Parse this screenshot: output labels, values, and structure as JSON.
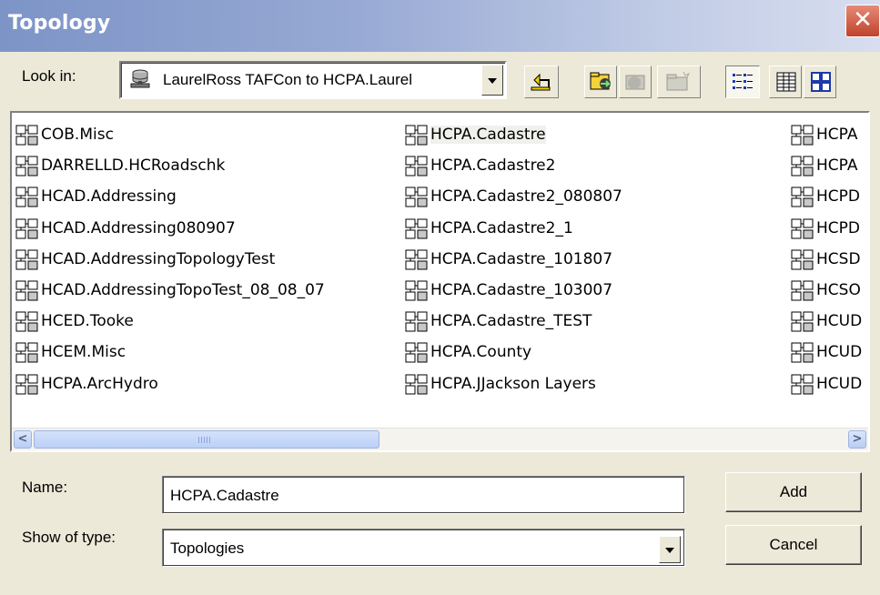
{
  "window": {
    "title": "Topology",
    "close_glyph": "✕"
  },
  "toolbar": {
    "look_in_label": "Look in:",
    "look_in_value": "LaurelRoss TAFCon to HCPA.Laurel",
    "buttons": [
      "up-one-level-icon",
      "connect-to-folder-icon",
      "disconnect-folder-icon",
      "new-folder-icon",
      "list-view-icon",
      "details-view-icon",
      "thumbnails-view-icon"
    ]
  },
  "files": {
    "column1": [
      "COB.Misc",
      "DARRELLD.HCRoadschk",
      "HCAD.Addressing",
      "HCAD.Addressing080907",
      "HCAD.AddressingTopologyTest",
      "HCAD.AddressingTopoTest_08_08_07",
      "HCED.Tooke",
      "HCEM.Misc",
      "HCPA.ArcHydro"
    ],
    "column2": [
      "HCPA.Cadastre",
      "HCPA.Cadastre2",
      "HCPA.Cadastre2_080807",
      "HCPA.Cadastre2_1",
      "HCPA.Cadastre_101807",
      "HCPA.Cadastre_103007",
      "HCPA.Cadastre_TEST",
      "HCPA.County",
      "HCPA.JJackson Layers"
    ],
    "column3": [
      "HCPA",
      "HCPA",
      "HCPD",
      "HCPD",
      "HCSD",
      "HCSO",
      "HCUD",
      "HCUD",
      "HCUD"
    ],
    "selected": "HCPA.Cadastre"
  },
  "scrollbar": {
    "left_arrow": "<",
    "right_arrow": ">"
  },
  "form": {
    "name_label": "Name:",
    "name_value": "HCPA.Cadastre",
    "type_label": "Show of type:",
    "type_value": "Topologies",
    "add_label": "Add",
    "cancel_label": "Cancel"
  }
}
